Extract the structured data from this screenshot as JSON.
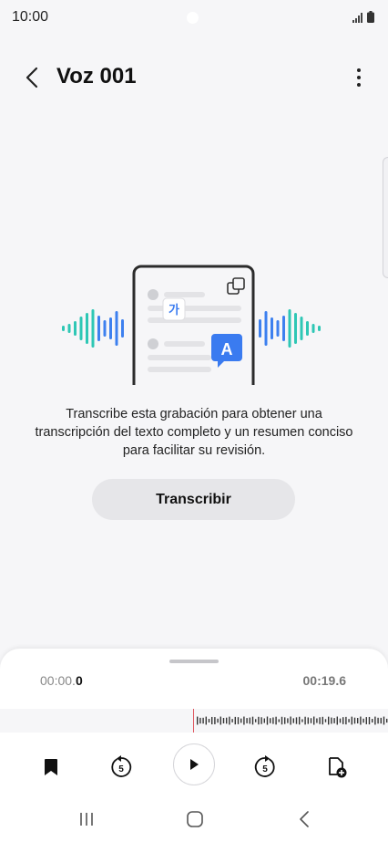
{
  "status_bar": {
    "time": "10:00"
  },
  "app_bar": {
    "title": "Voz 001"
  },
  "empty_state": {
    "description": "Transcribe esta grabación para obtener una transcripción del texto completo y un resumen conciso para facilitar su revisión.",
    "illustration_badge_a": "A",
    "illustration_badge_korean": "가"
  },
  "actions": {
    "transcribe_label": "Transcribir"
  },
  "player": {
    "current_time_dim": "00:00.",
    "current_time_bold": "0",
    "total_time": "00:19.6",
    "skip_back_seconds": "5",
    "skip_forward_seconds": "5",
    "progress": 0
  },
  "colors": {
    "accent_blue": "#3a7bf0",
    "wave_teal": "#2ec7b5",
    "wave_blue": "#3d80ef",
    "playhead": "#e0565e"
  },
  "icons": [
    "back-arrow-icon",
    "more-vert-icon",
    "bookmark-icon",
    "rewind-5-icon",
    "play-icon",
    "forward-5-icon",
    "add-document-icon",
    "recents-icon",
    "home-icon",
    "back-nav-icon"
  ]
}
